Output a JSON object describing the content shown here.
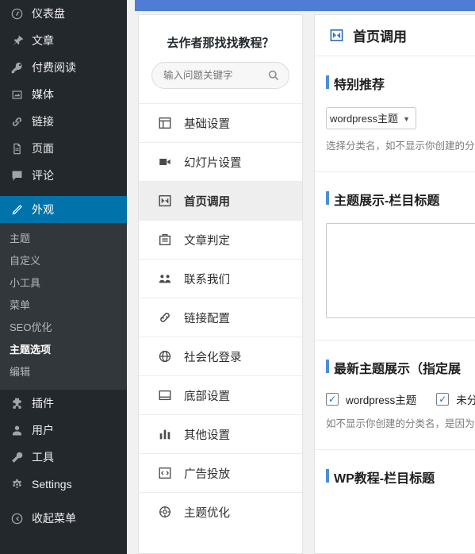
{
  "admin_menu": {
    "items": [
      {
        "label": "仪表盘",
        "icon": "dashboard-icon",
        "current": false
      },
      {
        "label": "文章",
        "icon": "pin-icon",
        "current": false
      },
      {
        "label": "付费阅读",
        "icon": "key-icon",
        "current": false
      },
      {
        "label": "媒体",
        "icon": "media-icon",
        "current": false
      },
      {
        "label": "链接",
        "icon": "link-icon",
        "current": false
      },
      {
        "label": "页面",
        "icon": "page-icon",
        "current": false
      },
      {
        "label": "评论",
        "icon": "comment-icon",
        "current": false
      },
      {
        "label": "外观",
        "icon": "appearance-icon",
        "current": true
      },
      {
        "label": "插件",
        "icon": "plugin-icon",
        "current": false
      },
      {
        "label": "用户",
        "icon": "user-icon",
        "current": false
      },
      {
        "label": "工具",
        "icon": "tools-icon",
        "current": false
      },
      {
        "label": "Settings",
        "icon": "settings-icon",
        "current": false
      },
      {
        "label": "收起菜单",
        "icon": "collapse-icon",
        "current": false
      }
    ],
    "appearance_submenu": [
      {
        "label": "主题",
        "current": false
      },
      {
        "label": "自定义",
        "current": false
      },
      {
        "label": "小工具",
        "current": false
      },
      {
        "label": "菜单",
        "current": false
      },
      {
        "label": "SEO优化",
        "current": false
      },
      {
        "label": "主题选项",
        "current": true
      },
      {
        "label": "编辑",
        "current": false
      }
    ]
  },
  "panel": {
    "title": "去作者那找找教程？",
    "search": {
      "placeholder": "输入问题关键字",
      "value": "",
      "icon": "search-icon"
    },
    "nav": [
      {
        "label": "基础设置",
        "icon": "grid-icon",
        "active": false
      },
      {
        "label": "幻灯片设置",
        "icon": "video-icon",
        "active": false
      },
      {
        "label": "首页调用",
        "icon": "home-call-icon",
        "active": true
      },
      {
        "label": "文章判定",
        "icon": "article-icon",
        "active": false
      },
      {
        "label": "联系我们",
        "icon": "contact-icon",
        "active": false
      },
      {
        "label": "链接配置",
        "icon": "chain-icon",
        "active": false
      },
      {
        "label": "社会化登录",
        "icon": "globe-icon",
        "active": false
      },
      {
        "label": "底部设置",
        "icon": "footer-icon",
        "active": false
      },
      {
        "label": "其他设置",
        "icon": "bars-icon",
        "active": false
      },
      {
        "label": "广告投放",
        "icon": "code-icon",
        "active": false
      },
      {
        "label": "主题优化",
        "icon": "optimize-icon",
        "active": false
      }
    ]
  },
  "settings": {
    "header": {
      "title": "首页调用",
      "icon": "home-call-icon"
    },
    "sections": [
      {
        "title": "特别推荐",
        "select_value": "wordpress主题",
        "hint": "选择分类名，如不显示你创建的分类"
      },
      {
        "title": "主题展示-栏目标题",
        "textarea_value": ""
      },
      {
        "title": "最新主题展示（指定展",
        "checkboxes": [
          {
            "label": "wordpress主题",
            "checked": true
          },
          {
            "label": "未分类",
            "checked": true
          }
        ],
        "hint": "如不显示你创建的分类名，是因为你"
      },
      {
        "title": "WP教程-栏目标题"
      }
    ]
  },
  "colors": {
    "admin_bg": "#23282d",
    "admin_submenu_bg": "#32373c",
    "accent": "#0073aa",
    "section_bar": "#4a8fd6",
    "topbar": "#4f7cd4"
  }
}
